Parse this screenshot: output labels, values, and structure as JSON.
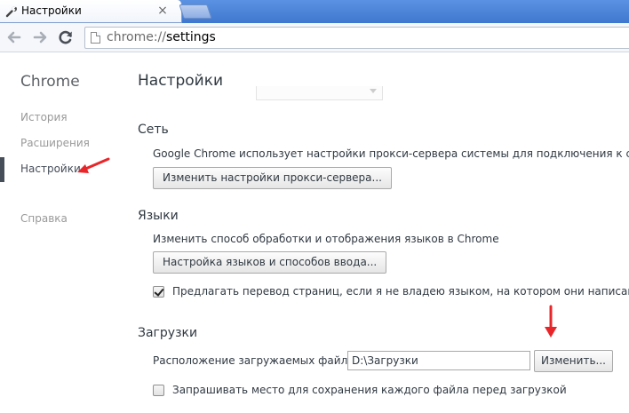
{
  "tab": {
    "title": "Настройки"
  },
  "address_bar": {
    "scheme": "chrome://",
    "host": "settings"
  },
  "sidebar": {
    "title": "Chrome",
    "items": [
      {
        "label": "История"
      },
      {
        "label": "Расширения"
      },
      {
        "label": "Настройки",
        "selected": true
      },
      {
        "label": "Справка"
      }
    ]
  },
  "page": {
    "title": "Настройки"
  },
  "network": {
    "title": "Сеть",
    "description": "Google Chrome использует настройки прокси-сервера системы для подключения к сети.",
    "button": "Изменить настройки прокси-сервера..."
  },
  "languages": {
    "title": "Языки",
    "description": "Изменить способ обработки и отображения языков в Chrome",
    "button": "Настройка языков и способов ввода...",
    "translate_checkbox": {
      "label": "Предлагать перевод страниц, если я не владею языком, на котором они написаны",
      "checked": true
    }
  },
  "downloads": {
    "title": "Загрузки",
    "location_label": "Расположение загружаемых файлов:",
    "location_value": "D:\\Загрузки",
    "change_button": "Изменить...",
    "ask_checkbox": {
      "label": "Запрашивать место для сохранения каждого файла перед загрузкой",
      "checked": false
    }
  },
  "colors": {
    "annotation": "#e8262a",
    "tabstrip": "#4f87d8"
  }
}
